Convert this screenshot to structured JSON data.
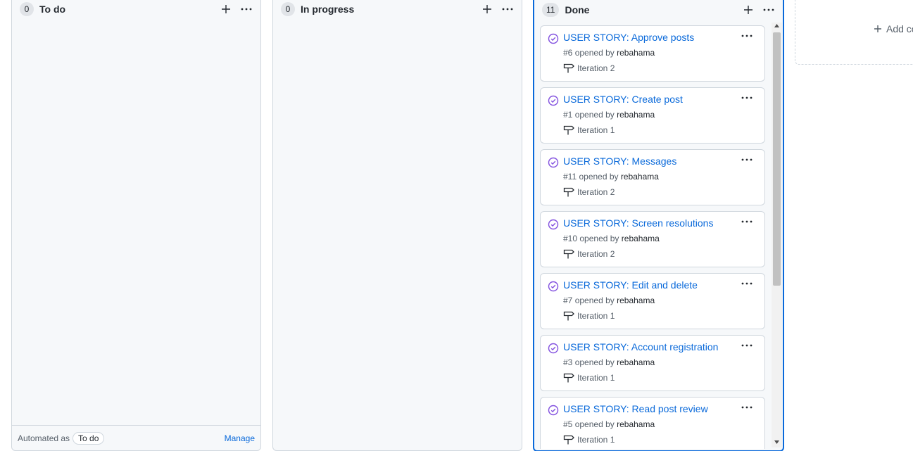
{
  "columns": [
    {
      "count": "0",
      "title": "To do"
    },
    {
      "count": "0",
      "title": "In progress"
    },
    {
      "count": "11",
      "title": "Done"
    }
  ],
  "footer": {
    "automated_label": "Automated as",
    "automated_value": "To do",
    "manage_label": "Manage"
  },
  "cards": [
    {
      "title": "USER STORY: Approve posts",
      "number": "#6",
      "opened_by": "opened by",
      "author": "rebahama",
      "milestone": "Iteration 2"
    },
    {
      "title": "USER STORY: Create post",
      "number": "#1",
      "opened_by": "opened by",
      "author": "rebahama",
      "milestone": "Iteration 1"
    },
    {
      "title": "USER STORY: Messages",
      "number": "#11",
      "opened_by": "opened by",
      "author": "rebahama",
      "milestone": "Iteration 2"
    },
    {
      "title": "USER STORY: Screen resolutions",
      "number": "#10",
      "opened_by": "opened by",
      "author": "rebahama",
      "milestone": "Iteration 2"
    },
    {
      "title": "USER STORY: Edit and delete",
      "number": "#7",
      "opened_by": "opened by",
      "author": "rebahama",
      "milestone": "Iteration 1"
    },
    {
      "title": "USER STORY: Account registration",
      "number": "#3",
      "opened_by": "opened by",
      "author": "rebahama",
      "milestone": "Iteration 1"
    },
    {
      "title": "USER STORY: Read post review",
      "number": "#5",
      "opened_by": "opened by",
      "author": "rebahama",
      "milestone": "Iteration 1"
    }
  ],
  "add_column": {
    "label": "Add co"
  },
  "icons": {
    "add": "plus-icon",
    "more": "kebab-horizontal-icon",
    "closed_issue": "issue-closed-icon",
    "milestone": "milestone-icon"
  },
  "colors": {
    "accent": "#0969da",
    "closed_issue": "#8250df",
    "border": "#d0d7de",
    "column_bg": "#f6f8fa"
  }
}
